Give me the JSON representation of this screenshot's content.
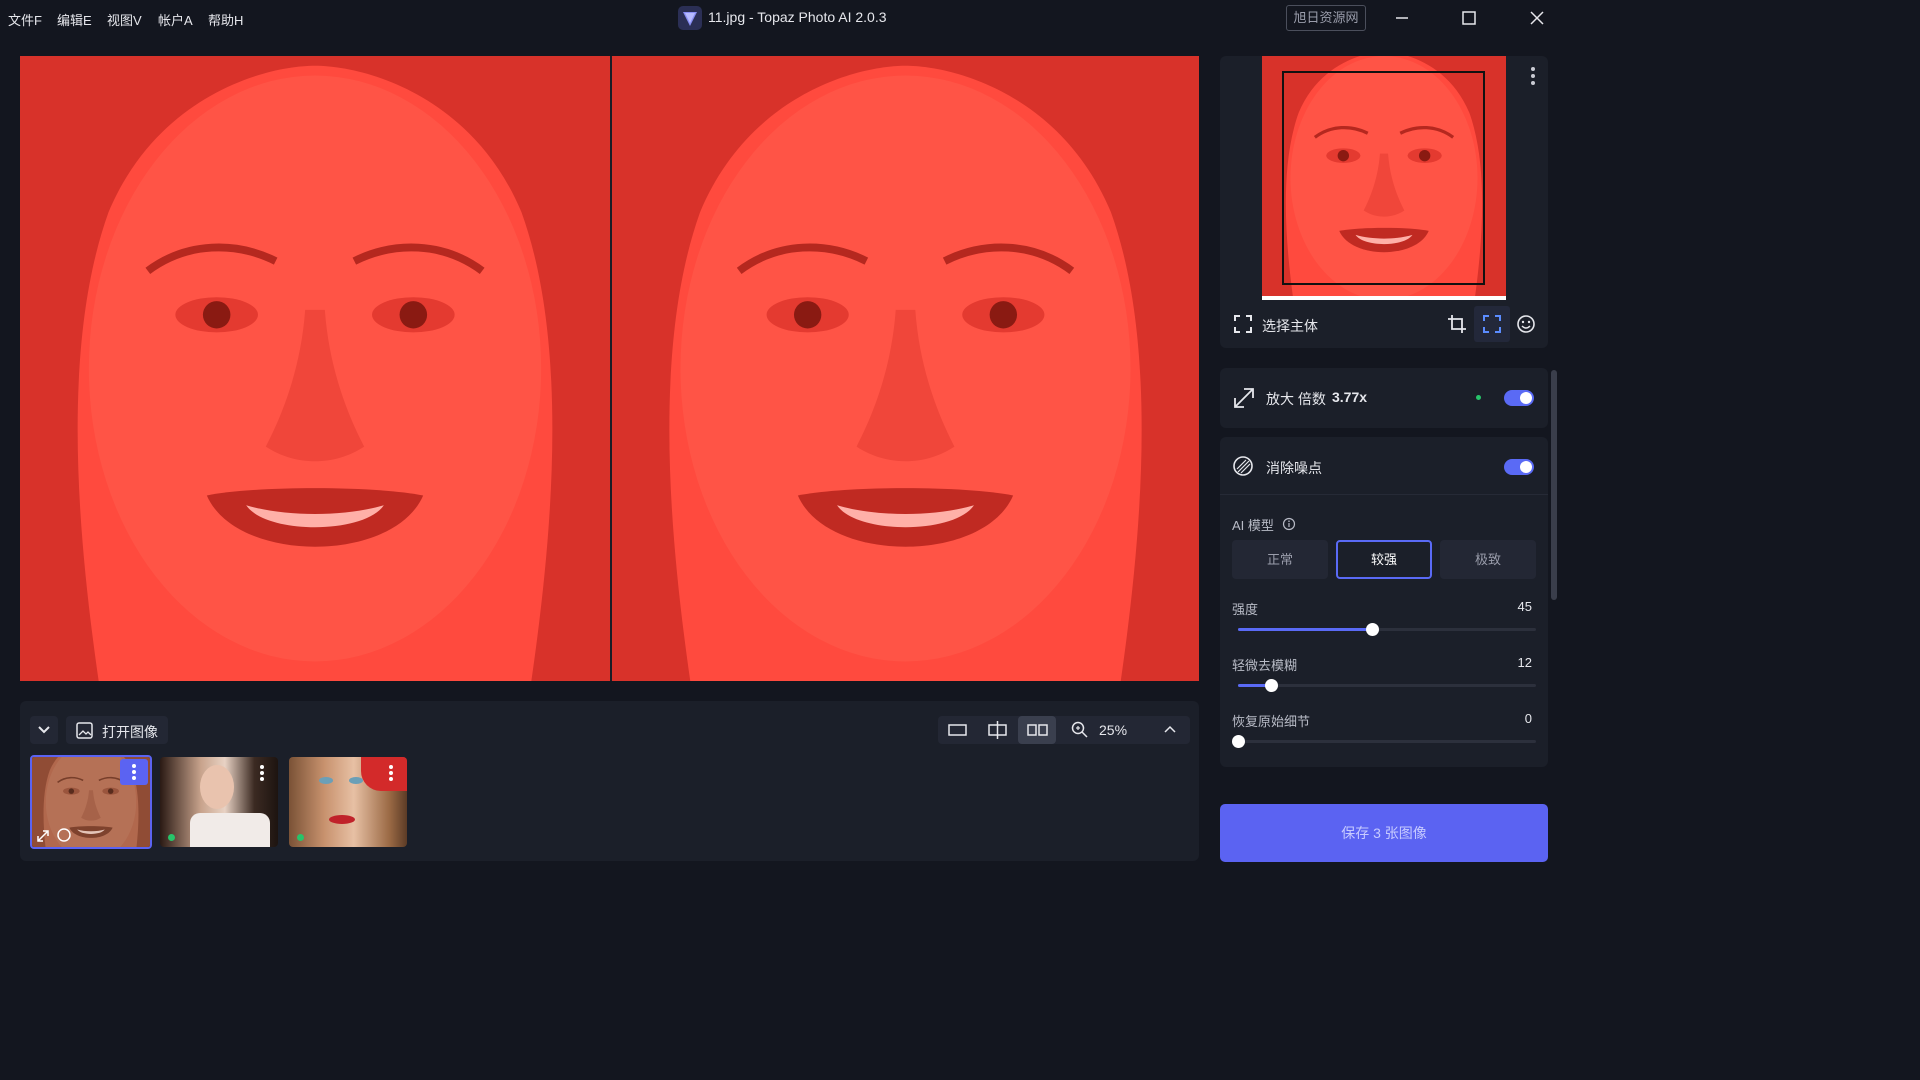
{
  "menu": [
    "文件F",
    "编辑E",
    "视图V",
    "帐户A",
    "帮助H"
  ],
  "window": {
    "title": "11.jpg - Topaz Photo AI 2.0.3",
    "watermark": "旭日资源网"
  },
  "preview": {
    "left_alt": "original",
    "right_alt": "processed"
  },
  "toolbar": {
    "open_image": "打开图像",
    "zoom": "25%"
  },
  "thumbnails": [
    {
      "name": "thumb-1",
      "selected": true
    },
    {
      "name": "thumb-2",
      "selected": false
    },
    {
      "name": "thumb-3",
      "selected": false
    }
  ],
  "navigator": {
    "select_subject": "选择主体"
  },
  "upscale": {
    "title": "放大 倍数",
    "factor": "3.77x",
    "enabled": true
  },
  "denoise": {
    "title": "消除噪点",
    "enabled": true,
    "ai_model_label": "AI 模型",
    "models": [
      "正常",
      "较强",
      "极致"
    ],
    "selected_model": "较强",
    "sliders": [
      {
        "label": "强度",
        "value": "45",
        "fraction": 0.45
      },
      {
        "label": "轻微去模糊",
        "value": "12",
        "fraction": 0.11
      },
      {
        "label": "恢复原始细节",
        "value": "0",
        "fraction": 0.0
      }
    ]
  },
  "save_button": "保存 3 张图像",
  "colors": {
    "accent": "#5b63f2",
    "overlay_red": "#ff4a3e",
    "panel": "#1b1f29",
    "background": "#13161f"
  }
}
